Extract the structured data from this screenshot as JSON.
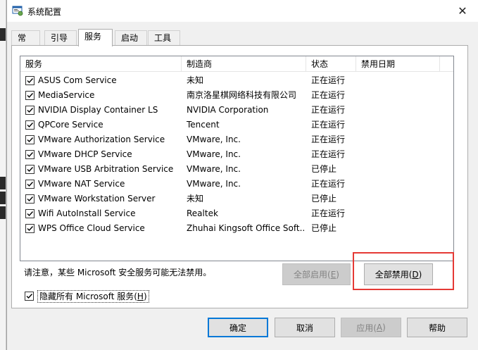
{
  "window": {
    "title": "系统配置",
    "close": "✕"
  },
  "tabs": [
    {
      "label": "常规"
    },
    {
      "label": "引导"
    },
    {
      "label": "服务"
    },
    {
      "label": "启动"
    },
    {
      "label": "工具"
    }
  ],
  "columns": {
    "service": "服务",
    "manufacturer": "制造商",
    "status": "状态",
    "disabled_date": "禁用日期"
  },
  "services": [
    {
      "name": "ASUS Com Service",
      "manufacturer": "未知",
      "status": "正在运行",
      "disabled_date": "",
      "checked": true
    },
    {
      "name": "MediaService",
      "manufacturer": "南京洛星棋网络科技有限公司",
      "status": "正在运行",
      "disabled_date": "",
      "checked": true
    },
    {
      "name": "NVIDIA Display Container LS",
      "manufacturer": "NVIDIA Corporation",
      "status": "正在运行",
      "disabled_date": "",
      "checked": true
    },
    {
      "name": "QPCore Service",
      "manufacturer": "Tencent",
      "status": "正在运行",
      "disabled_date": "",
      "checked": true
    },
    {
      "name": "VMware Authorization Service",
      "manufacturer": "VMware, Inc.",
      "status": "正在运行",
      "disabled_date": "",
      "checked": true
    },
    {
      "name": "VMware DHCP Service",
      "manufacturer": "VMware, Inc.",
      "status": "正在运行",
      "disabled_date": "",
      "checked": true
    },
    {
      "name": "VMware USB Arbitration Service",
      "manufacturer": "VMware, Inc.",
      "status": "已停止",
      "disabled_date": "",
      "checked": true
    },
    {
      "name": "VMware NAT Service",
      "manufacturer": "VMware, Inc.",
      "status": "正在运行",
      "disabled_date": "",
      "checked": true
    },
    {
      "name": "VMware Workstation Server",
      "manufacturer": "未知",
      "status": "已停止",
      "disabled_date": "",
      "checked": true
    },
    {
      "name": "Wifi AutoInstall Service",
      "manufacturer": "Realtek",
      "status": "正在运行",
      "disabled_date": "",
      "checked": true
    },
    {
      "name": "WPS Office Cloud Service",
      "manufacturer": "Zhuhai Kingsoft Office Soft...",
      "status": "已停止",
      "disabled_date": "",
      "checked": true
    }
  ],
  "note": "请注意，某些 Microsoft 安全服务可能无法禁用。",
  "enable_all": {
    "label": "全部启用(",
    "key": "E",
    "suffix": ")"
  },
  "disable_all": {
    "label": "全部禁用(",
    "key": "D",
    "suffix": ")"
  },
  "hide_ms": {
    "label": "隐藏所有 Microsoft 服务(",
    "key": "H",
    "suffix": ")",
    "checked": true
  },
  "footer": {
    "ok": "确定",
    "cancel": "取消",
    "apply": {
      "label": "应用(",
      "key": "A",
      "suffix": ")"
    },
    "help": "帮助"
  },
  "colors": {
    "highlight": "#e53935",
    "focus": "#0078d7"
  }
}
